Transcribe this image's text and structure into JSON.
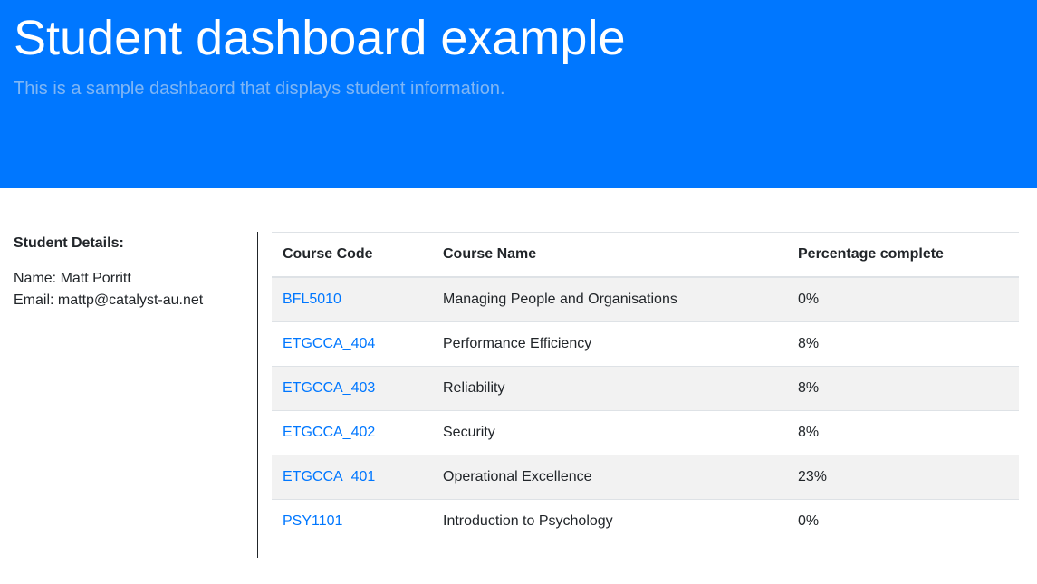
{
  "hero": {
    "title": "Student dashboard example",
    "subtitle": "This is a sample dashbaord that displays student information."
  },
  "student": {
    "heading": "Student Details:",
    "name_line": "Name: Matt Porritt",
    "email_line": "Email: mattp@catalyst-au.net"
  },
  "table": {
    "headers": [
      "Course Code",
      "Course Name",
      "Percentage complete"
    ],
    "rows": [
      {
        "code": "BFL5010",
        "name": "Managing People and Organisations",
        "percent": "0%"
      },
      {
        "code": "ETGCCA_404",
        "name": "Performance Efficiency",
        "percent": "8%"
      },
      {
        "code": "ETGCCA_403",
        "name": "Reliability",
        "percent": "8%"
      },
      {
        "code": "ETGCCA_402",
        "name": "Security",
        "percent": "8%"
      },
      {
        "code": "ETGCCA_401",
        "name": "Operational Excellence",
        "percent": "23%"
      },
      {
        "code": "PSY1101",
        "name": "Introduction to Psychology",
        "percent": "0%"
      }
    ]
  },
  "colors": {
    "hero_bg": "#0077ff",
    "link": "#0077ff",
    "stripe": "#f2f2f2"
  }
}
